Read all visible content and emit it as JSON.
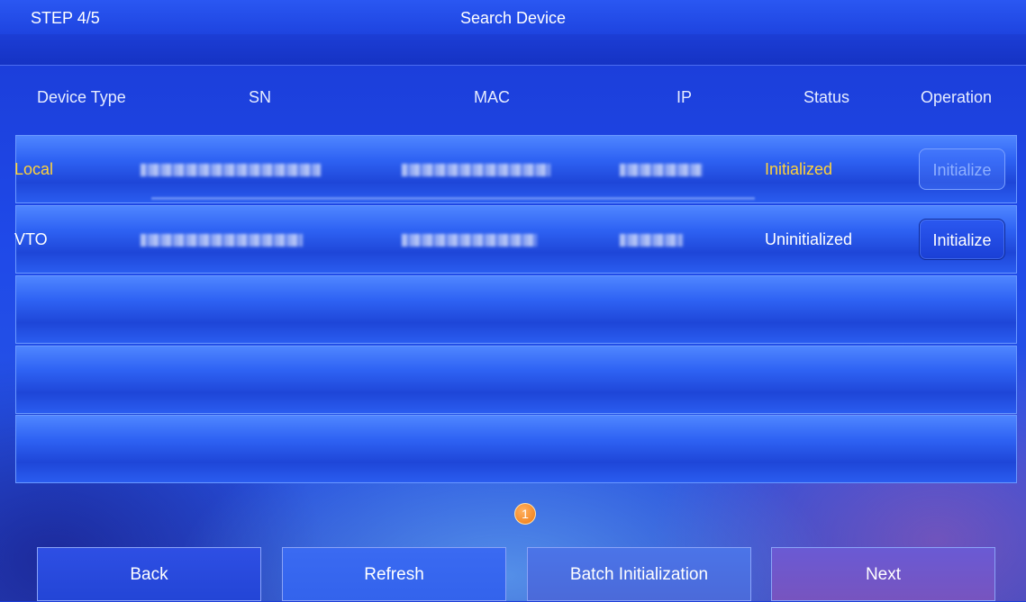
{
  "header": {
    "step": "STEP 4/5",
    "title": "Search Device"
  },
  "columns": {
    "device_type": "Device Type",
    "sn": "SN",
    "mac": "MAC",
    "ip": "IP",
    "status": "Status",
    "operation": "Operation"
  },
  "rows": [
    {
      "device_type": "Local",
      "status": "Initialized",
      "operation": "Initialize",
      "operation_enabled": false,
      "highlight_color": "#ffd23a"
    },
    {
      "device_type": "VTO",
      "status": "Uninitialized",
      "operation": "Initialize",
      "operation_enabled": true
    }
  ],
  "pagination": {
    "current_page": "1"
  },
  "footer": {
    "back": "Back",
    "refresh": "Refresh",
    "batch": "Batch Initialization",
    "next": "Next"
  }
}
